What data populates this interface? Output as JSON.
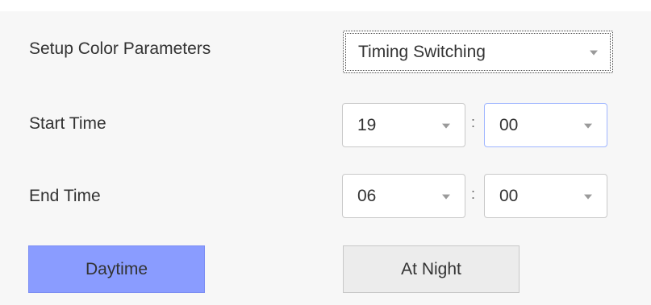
{
  "rows": {
    "color_params": {
      "label": "Setup Color Parameters",
      "value": "Timing Switching"
    },
    "start_time": {
      "label": "Start Time",
      "hour": "19",
      "minute": "00",
      "separator": ":"
    },
    "end_time": {
      "label": "End Time",
      "hour": "06",
      "minute": "00",
      "separator": ":"
    }
  },
  "buttons": {
    "daytime": "Daytime",
    "at_night": "At Night"
  },
  "colors": {
    "daytime_selected": "#8a9cff",
    "night_button": "#ececec",
    "focus_border": "#9fb6ff"
  },
  "icons": {
    "dropdown": "chevron-down-icon"
  }
}
